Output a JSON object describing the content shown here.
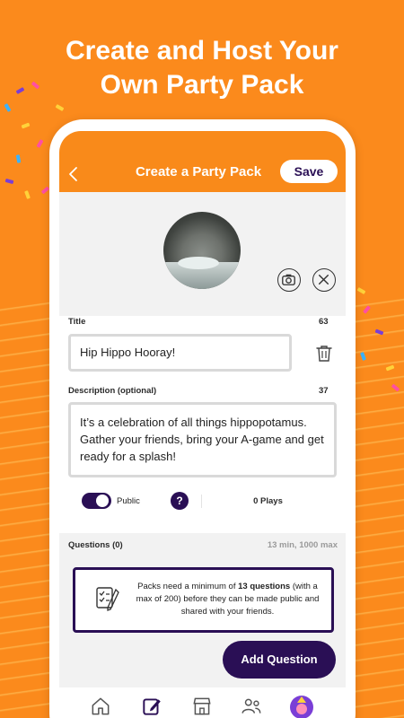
{
  "headline": {
    "line1": "Create and Host Your",
    "line2": "Own Party Pack"
  },
  "colors": {
    "background": "#fb8a1c",
    "app_bar": "#f98a1a",
    "primary_purple": "#2a0f55",
    "confetti": [
      "#7a3ed6",
      "#ff4fa3",
      "#3ab3ff",
      "#ffd23a",
      "#ffffff"
    ]
  },
  "app_bar": {
    "back_icon": "chevron-left-icon",
    "title": "Create a Party Pack",
    "save_label": "Save"
  },
  "cover": {
    "image": "hippo-photo",
    "camera_icon": "camera-icon",
    "remove_icon": "close-icon"
  },
  "title_field": {
    "label": "Title",
    "counter": "63",
    "value": "Hip Hippo Hooray!",
    "delete_icon": "trash-icon"
  },
  "description_field": {
    "label": "Description (optional)",
    "counter": "37",
    "value": "It’s a celebration of all things hippopotamus. Gather your friends, bring your A-game and get ready for a splash!"
  },
  "visibility": {
    "toggle_on": true,
    "label": "Public",
    "help_label": "?",
    "plays": "0 Plays"
  },
  "questions": {
    "label": "Questions (0)",
    "meta": "13 min, 1000 max"
  },
  "notice": {
    "icon": "checklist-pen-icon",
    "text_before": "Packs need a minimum of ",
    "text_bold": "13 questions",
    "text_after": " (with a max of 200) before they can be made public and shared with your friends."
  },
  "add_question_label": "Add Question",
  "tabs": [
    {
      "name": "home",
      "icon": "home-icon"
    },
    {
      "name": "create",
      "icon": "edit-icon"
    },
    {
      "name": "shop",
      "icon": "store-icon"
    },
    {
      "name": "friends",
      "icon": "people-icon"
    },
    {
      "name": "profile",
      "icon": "avatar-icon"
    }
  ]
}
